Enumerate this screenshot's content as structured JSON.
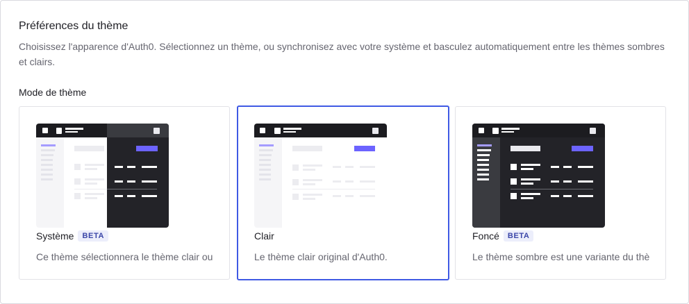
{
  "section": {
    "title": "Préférences du thème",
    "description": "Choisissez l'apparence d'Auth0. Sélectionnez un thème, ou synchronisez avec votre système et basculez automatiquement entre les thèmes sombres et clairs.",
    "mode_label": "Mode de thème"
  },
  "themes": [
    {
      "name": "Système",
      "badge": "BETA",
      "description": "Ce thème sélectionnera le thème clair ou sombre selon votre système",
      "selected": false
    },
    {
      "name": "Clair",
      "badge": "",
      "description": "Le thème clair original d'Auth0.",
      "selected": true
    },
    {
      "name": "Foncé",
      "badge": "BETA",
      "description": "Le thème sombre est une variante du thème clair",
      "selected": false
    }
  ],
  "colors": {
    "accent": "#6c63ff",
    "selected_border": "#3f59e4",
    "dark_bg": "#232328",
    "dark_sidebar": "#3a3b40",
    "light_sidebar": "#f5f5f7"
  }
}
